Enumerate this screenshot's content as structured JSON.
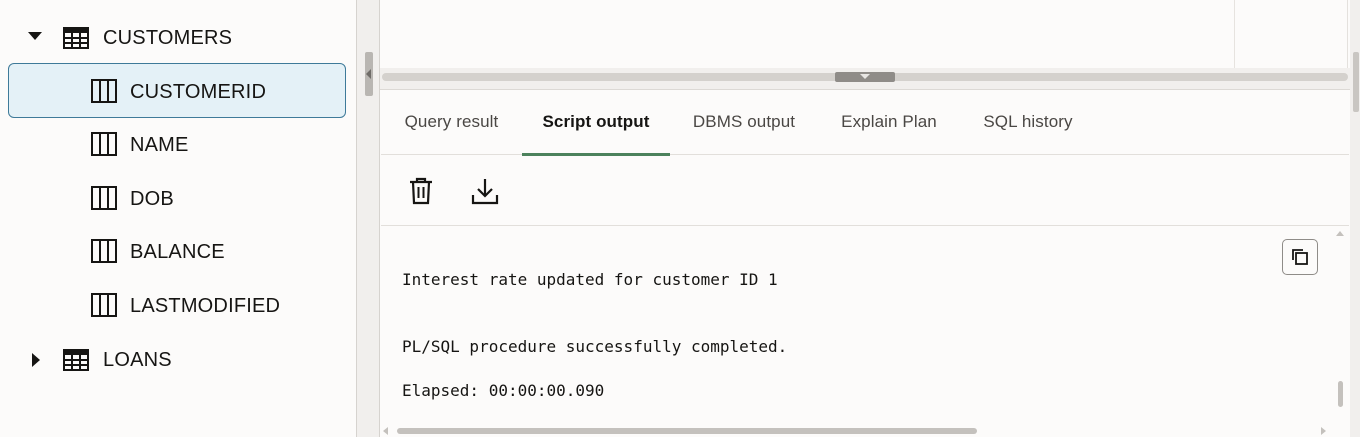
{
  "tree": {
    "tables": [
      {
        "name": "CUSTOMERS",
        "expanded": true
      },
      {
        "name": "LOANS",
        "expanded": false
      }
    ],
    "columns": [
      {
        "name": "CUSTOMERID",
        "selected": true
      },
      {
        "name": "NAME",
        "selected": false
      },
      {
        "name": "DOB",
        "selected": false
      },
      {
        "name": "BALANCE",
        "selected": false
      },
      {
        "name": "LASTMODIFIED",
        "selected": false
      }
    ]
  },
  "tabs": [
    {
      "label": "Query result",
      "active": false
    },
    {
      "label": "Script output",
      "active": true
    },
    {
      "label": "DBMS output",
      "active": false
    },
    {
      "label": "Explain Plan",
      "active": false
    },
    {
      "label": "SQL history",
      "active": false
    }
  ],
  "toolbar": {
    "icons": [
      "trash-icon",
      "download-icon"
    ]
  },
  "output": {
    "lines": [
      "Interest rate updated for customer ID 1",
      "PL/SQL procedure successfully completed.",
      "Elapsed: 00:00:00.090"
    ],
    "copy_icon": "copy-icon"
  },
  "colors": {
    "selected_bg": "#e4f1f7",
    "selected_border": "#3e7a99",
    "active_tab_underline": "#4c825c"
  }
}
